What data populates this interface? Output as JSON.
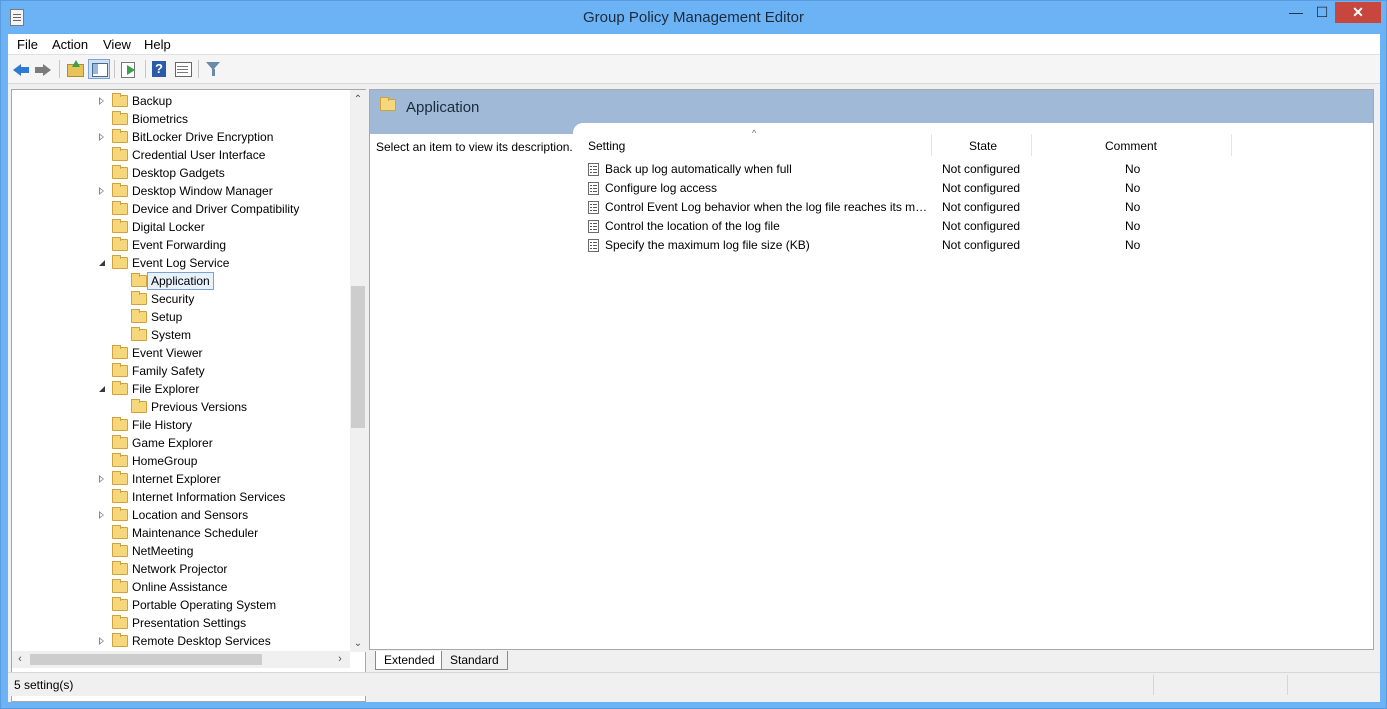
{
  "window": {
    "title": "Group Policy Management Editor",
    "minimize_glyph": "—",
    "maximize_glyph": "☐",
    "close_glyph": "✕"
  },
  "menu": [
    "File",
    "Action",
    "View",
    "Help"
  ],
  "toolbar": {
    "icons": [
      "back-icon",
      "forward-icon",
      "up-folder-icon",
      "show-console-tree-icon",
      "export-list-icon",
      "help-icon",
      "properties-icon",
      "filter-icon"
    ]
  },
  "tree": {
    "items": [
      {
        "label": "Backup",
        "level": 0,
        "expander": "collapsed"
      },
      {
        "label": "Biometrics",
        "level": 0,
        "expander": "none"
      },
      {
        "label": "BitLocker Drive Encryption",
        "level": 0,
        "expander": "collapsed"
      },
      {
        "label": "Credential User Interface",
        "level": 0,
        "expander": "none"
      },
      {
        "label": "Desktop Gadgets",
        "level": 0,
        "expander": "none"
      },
      {
        "label": "Desktop Window Manager",
        "level": 0,
        "expander": "collapsed"
      },
      {
        "label": "Device and Driver Compatibility",
        "level": 0,
        "expander": "none"
      },
      {
        "label": "Digital Locker",
        "level": 0,
        "expander": "none"
      },
      {
        "label": "Event Forwarding",
        "level": 0,
        "expander": "none"
      },
      {
        "label": "Event Log Service",
        "level": 0,
        "expander": "expanded"
      },
      {
        "label": "Application",
        "level": 1,
        "expander": "none",
        "selected": true
      },
      {
        "label": "Security",
        "level": 1,
        "expander": "none"
      },
      {
        "label": "Setup",
        "level": 1,
        "expander": "none"
      },
      {
        "label": "System",
        "level": 1,
        "expander": "none"
      },
      {
        "label": "Event Viewer",
        "level": 0,
        "expander": "none"
      },
      {
        "label": "Family Safety",
        "level": 0,
        "expander": "none"
      },
      {
        "label": "File Explorer",
        "level": 0,
        "expander": "expanded"
      },
      {
        "label": "Previous Versions",
        "level": 1,
        "expander": "none"
      },
      {
        "label": "File History",
        "level": 0,
        "expander": "none"
      },
      {
        "label": "Game Explorer",
        "level": 0,
        "expander": "none"
      },
      {
        "label": "HomeGroup",
        "level": 0,
        "expander": "none"
      },
      {
        "label": "Internet Explorer",
        "level": 0,
        "expander": "collapsed"
      },
      {
        "label": "Internet Information Services",
        "level": 0,
        "expander": "none"
      },
      {
        "label": "Location and Sensors",
        "level": 0,
        "expander": "collapsed"
      },
      {
        "label": "Maintenance Scheduler",
        "level": 0,
        "expander": "none"
      },
      {
        "label": "NetMeeting",
        "level": 0,
        "expander": "none"
      },
      {
        "label": "Network Projector",
        "level": 0,
        "expander": "none"
      },
      {
        "label": "Online Assistance",
        "level": 0,
        "expander": "none"
      },
      {
        "label": "Portable Operating System",
        "level": 0,
        "expander": "none"
      },
      {
        "label": "Presentation Settings",
        "level": 0,
        "expander": "none"
      },
      {
        "label": "Remote Desktop Services",
        "level": 0,
        "expander": "collapsed"
      }
    ]
  },
  "right": {
    "title": "Application",
    "description": "Select an item to view its description.",
    "columns": {
      "setting": "Setting",
      "state": "State",
      "comment": "Comment"
    },
    "sort_glyph": "^",
    "rows": [
      {
        "setting": "Back up log automatically when full",
        "state": "Not configured",
        "comment": "No"
      },
      {
        "setting": "Configure log access",
        "state": "Not configured",
        "comment": "No"
      },
      {
        "setting": "Control Event Log behavior when the log file reaches its maximum size",
        "state": "Not configured",
        "comment": "No"
      },
      {
        "setting": "Control the location of the log file",
        "state": "Not configured",
        "comment": "No"
      },
      {
        "setting": "Specify the maximum log file size (KB)",
        "state": "Not configured",
        "comment": "No"
      }
    ]
  },
  "tabs": [
    "Extended",
    "Standard"
  ],
  "status": {
    "text": "5 setting(s)"
  },
  "scroll_glyphs": {
    "up": "⌃",
    "down": "⌄",
    "left": "‹",
    "right": "›"
  }
}
